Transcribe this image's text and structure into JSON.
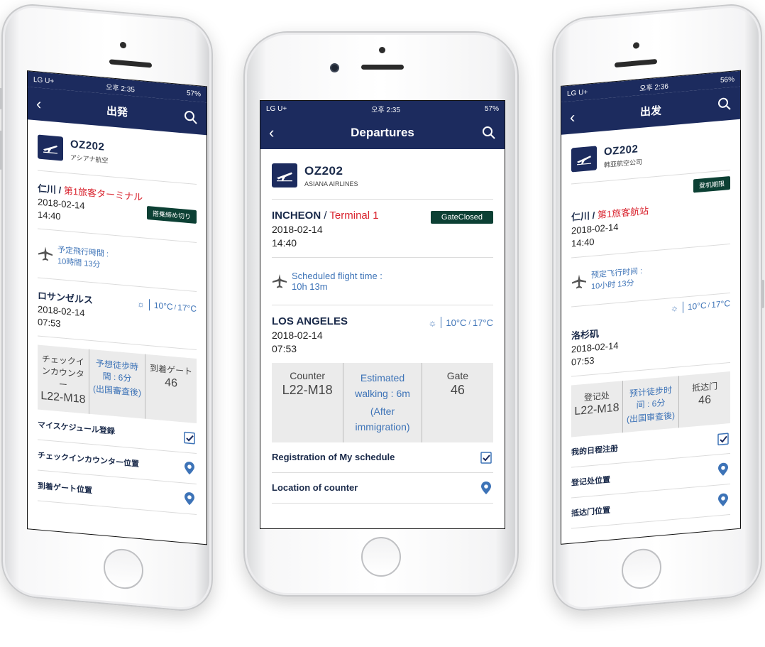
{
  "colors": {
    "navy": "#1c2b5e",
    "red": "#d9232e",
    "blue": "#3d73b7",
    "badge_green": "#0c4034",
    "gray_box": "#ebebeb"
  },
  "center": {
    "status": {
      "carrier": "LG U+",
      "time": "오후 2:35",
      "battery": "57%"
    },
    "nav_title": "Departures",
    "flight_no": "OZ202",
    "airline": "ASIANA AIRLINES",
    "origin": {
      "city": "INCHEON",
      "sep": " / ",
      "terminal": "Terminal 1",
      "date": "2018-02-14",
      "time": "14:40",
      "badge": "GateClosed"
    },
    "duration": {
      "label": "Scheduled flight time :",
      "value": "10h 13m"
    },
    "destination": {
      "city": "LOS ANGELES",
      "date": "2018-02-14",
      "time": "07:53",
      "weather_icon": "sun-icon",
      "temp": "10°C",
      "temp_sep": "/",
      "temp2": "17°C"
    },
    "info": {
      "counter_label": "Counter",
      "counter_value": "L22-M18",
      "walk_label": "Estimated walking : 6m",
      "walk_note": "(After immigration)",
      "gate_label": "Gate",
      "gate_value": "46"
    },
    "list": [
      "Registration of My schedule",
      "Location of counter"
    ]
  },
  "left": {
    "status": {
      "carrier": "LG U+",
      "time": "오후 2:35",
      "battery": "57%"
    },
    "nav_title": "出発",
    "flight_no": "OZ202",
    "airline": "アシアナ航空",
    "origin": {
      "city": "仁川",
      "sep": " / ",
      "terminal": "第1旅客ターミナル",
      "date": "2018-02-14",
      "time": "14:40",
      "badge": "搭乗締め切り"
    },
    "duration": {
      "label": "予定飛行時間 :",
      "value": "10時間 13分"
    },
    "destination": {
      "city": "ロサンゼルス",
      "date": "2018-02-14",
      "time": "07:53",
      "temp": "10°C",
      "temp_sep": "/",
      "temp2": "17°C"
    },
    "info": {
      "counter_label": "チェックインカウンター",
      "counter_value": "L22-M18",
      "walk_label": "予想徒歩時間 : 6分",
      "walk_note": "(出国審査後)",
      "gate_label": "到着ゲート",
      "gate_value": "46"
    },
    "list": [
      "マイスケジュール登録",
      "チェックインカウンター位置",
      "到着ゲート位置"
    ]
  },
  "right": {
    "status": {
      "carrier": "LG U+",
      "time": "오후 2:36",
      "battery": "56%"
    },
    "nav_title": "出发",
    "flight_no": "OZ202",
    "airline": "韩亚航空公司",
    "origin": {
      "city": "仁川",
      "sep": " / ",
      "terminal": "第1旅客航站",
      "date": "2018-02-14",
      "time": "14:40",
      "badge": "登机期限"
    },
    "duration": {
      "label": "预定飞行时间 :",
      "value": "10小时 13分"
    },
    "destination": {
      "city": "洛杉矶",
      "date": "2018-02-14",
      "time": "07:53",
      "temp": "10°C",
      "temp_sep": "/",
      "temp2": "17°C"
    },
    "info": {
      "counter_label": "登记处",
      "counter_value": "L22-M18",
      "walk_label": "预计徒步时间 : 6分",
      "walk_note": "(出国审查後)",
      "gate_label": "抵达门",
      "gate_value": "46"
    },
    "list": [
      "我的日程注册",
      "登记处位置",
      "抵达门位置"
    ]
  }
}
